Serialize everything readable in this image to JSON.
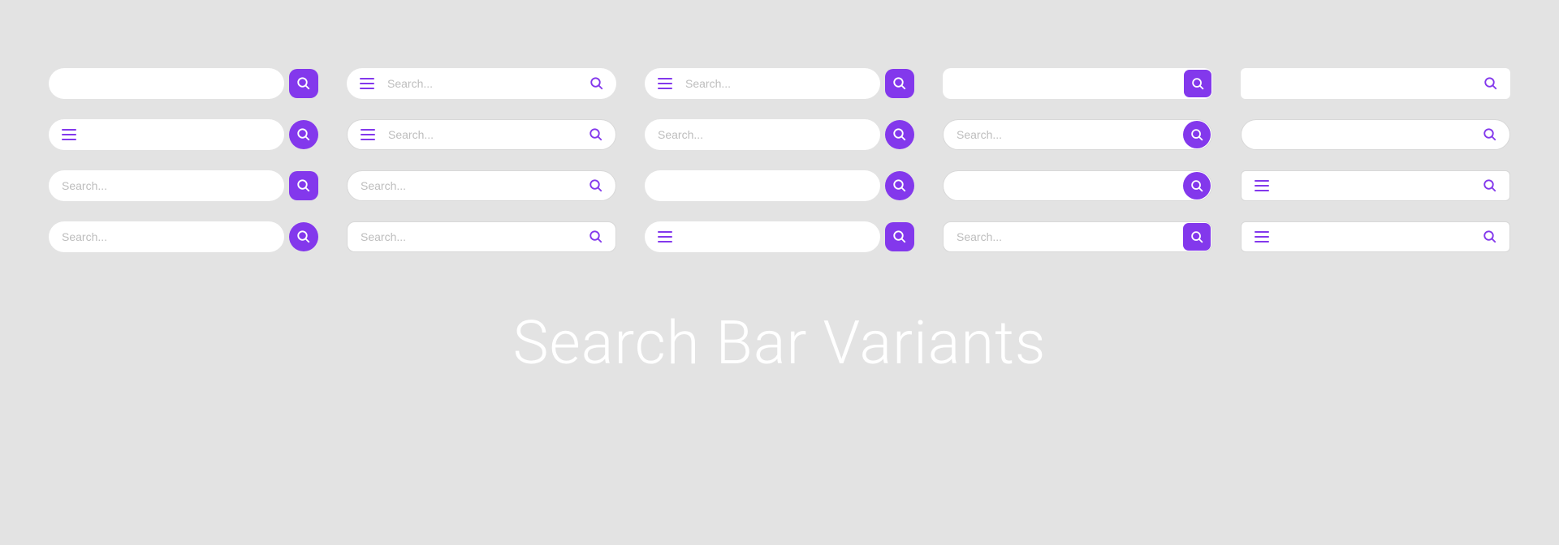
{
  "title": "Search Bar Variants",
  "placeholder": "Search...",
  "colors": {
    "accent": "#8338ec",
    "bg": "#e3e3e3",
    "white": "#ffffff"
  }
}
